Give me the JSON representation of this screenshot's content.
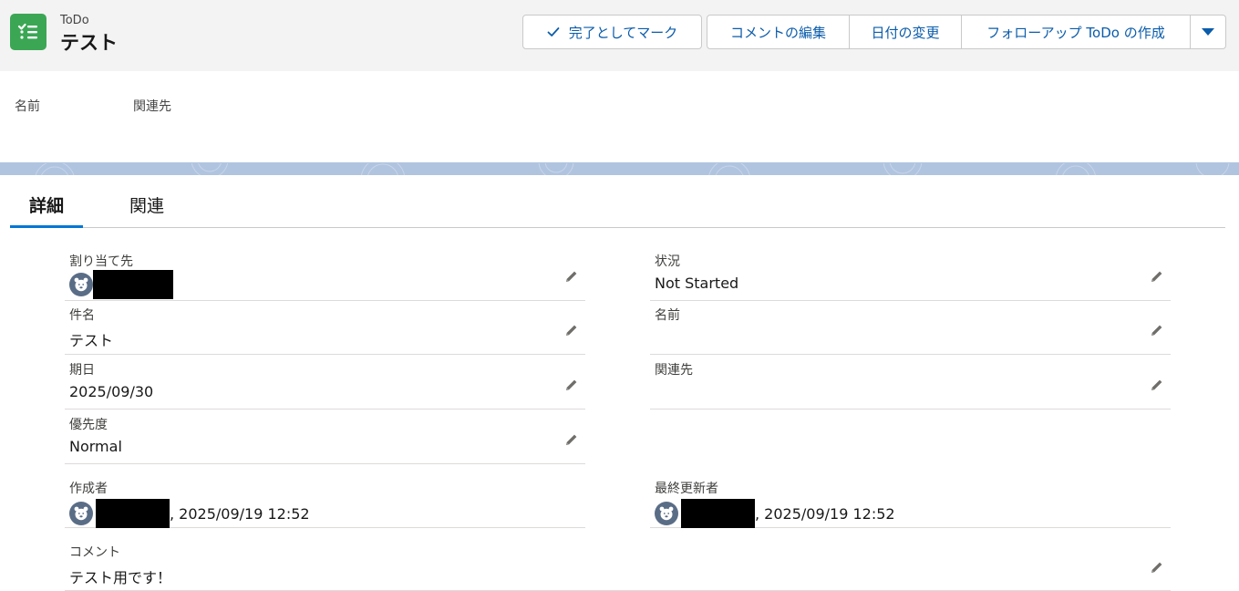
{
  "header": {
    "object_type": "ToDo",
    "title": "テスト",
    "actions": {
      "mark_complete": "完了としてマーク",
      "edit_comment": "コメントの編集",
      "change_date": "日付の変更",
      "create_followup": "フォローアップ ToDo の作成"
    },
    "icons": {
      "object": "task-checklist-icon",
      "check": "check-icon",
      "more": "chevron-down-icon"
    }
  },
  "highlights": {
    "name_label": "名前",
    "related_label": "関連先"
  },
  "tabs": [
    {
      "label": "詳細",
      "active": true
    },
    {
      "label": "関連",
      "active": false
    }
  ],
  "fields": {
    "assigned_to": {
      "label": "割り当て先",
      "value": ""
    },
    "status": {
      "label": "状況",
      "value": "Not Started"
    },
    "subject": {
      "label": "件名",
      "value": "テスト"
    },
    "name": {
      "label": "名前",
      "value": ""
    },
    "due_date": {
      "label": "期日",
      "value": "2025/09/30"
    },
    "related_to": {
      "label": "関連先",
      "value": ""
    },
    "priority": {
      "label": "優先度",
      "value": "Normal"
    },
    "created_by": {
      "label": "作成者",
      "value": ", 2025/09/19 12:52"
    },
    "last_modified_by": {
      "label": "最終更新者",
      "value": ", 2025/09/19 12:52"
    },
    "comment": {
      "label": "コメント",
      "value": "テスト用です！"
    }
  },
  "colors": {
    "brand_blue": "#0176d3",
    "link_blue": "#0b5cab",
    "task_green": "#3ba755",
    "avatar": "#5a6d86"
  }
}
